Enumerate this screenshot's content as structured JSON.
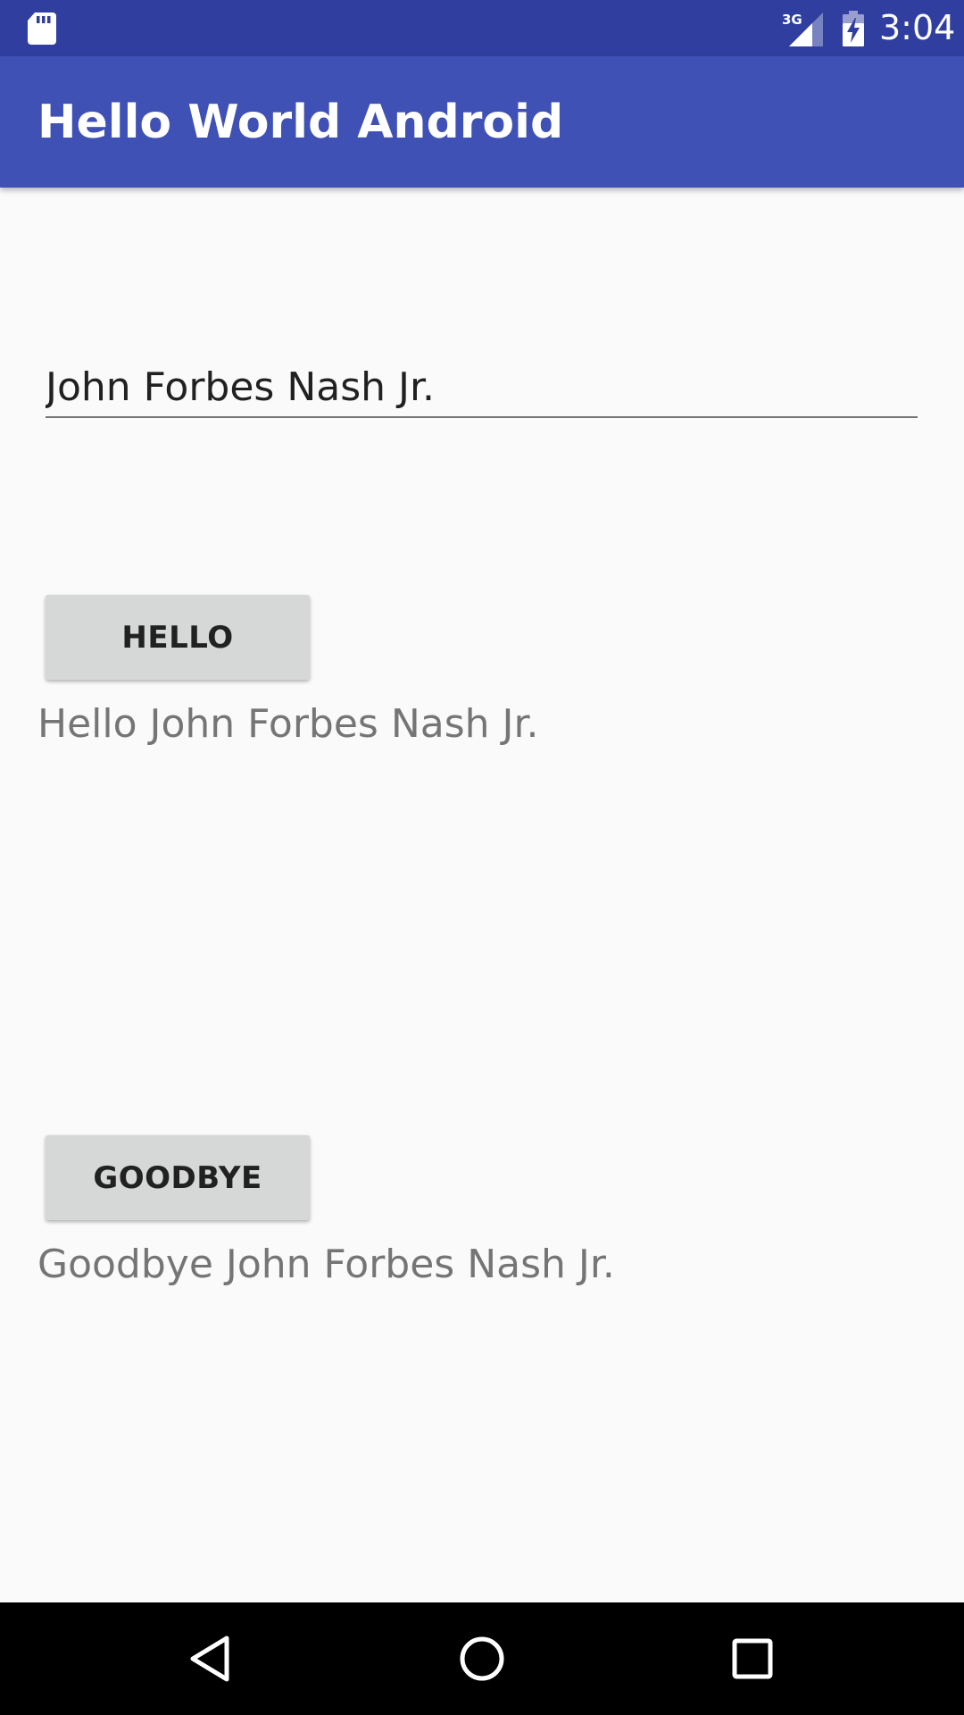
{
  "status_bar": {
    "time": "3:04",
    "network_label": "3G",
    "icons": [
      "sd-card-icon",
      "signal-3g-icon",
      "battery-charging-icon"
    ]
  },
  "app_bar": {
    "title": "Hello World Android",
    "color": "#3f51b5",
    "status_color": "#303f9f"
  },
  "form": {
    "name_value": "John Forbes Nash Jr."
  },
  "hello": {
    "button_label": "HELLO",
    "result_text": "Hello John Forbes Nash Jr."
  },
  "goodbye": {
    "button_label": "GOODBYE",
    "result_text": "Goodbye John Forbes Nash Jr."
  },
  "nav_bar": {
    "icons": [
      "back-icon",
      "home-icon",
      "recents-icon"
    ]
  }
}
